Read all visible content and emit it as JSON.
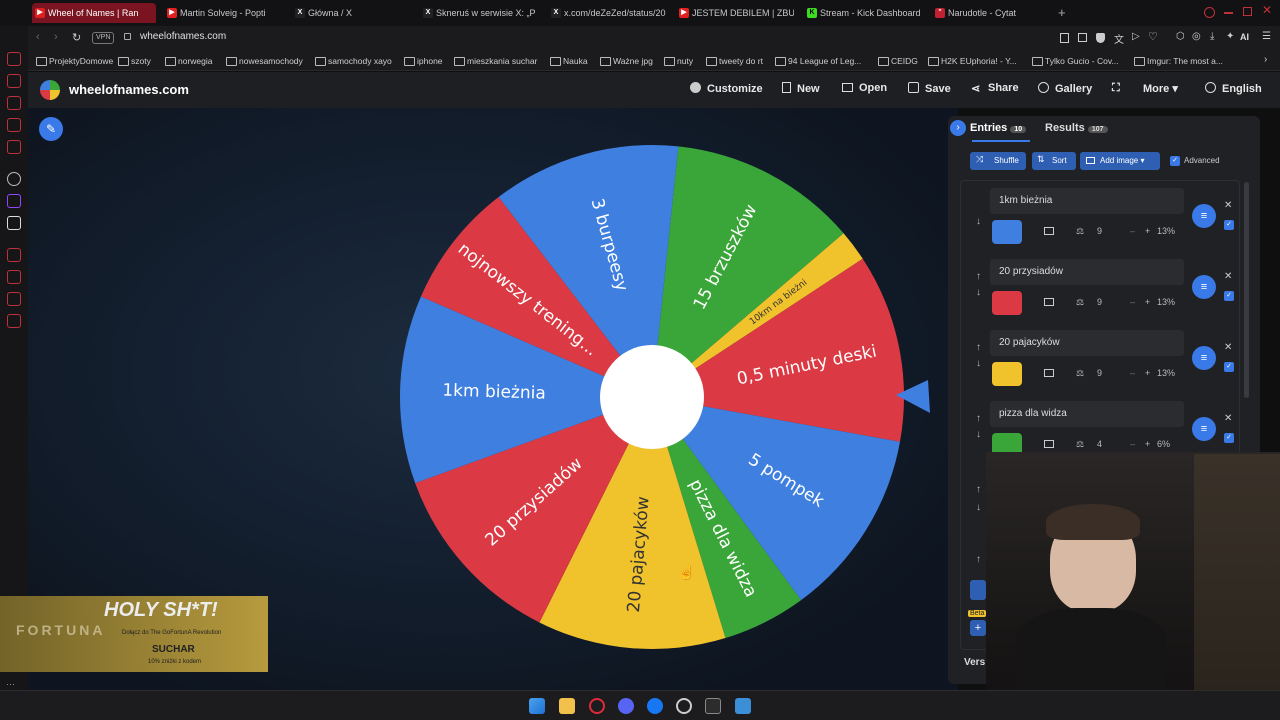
{
  "browser": {
    "tabs": [
      {
        "title": "Wheel of Names | Ran",
        "active": true,
        "icon": "youtube-icon"
      },
      {
        "title": "Martin Solveig - Popti",
        "icon": "youtube-icon"
      },
      {
        "title": "Główna / X",
        "icon": "x-icon"
      },
      {
        "title": "Skneruś w serwisie X: „P",
        "icon": "x-icon"
      },
      {
        "title": "x.com/deZeZed/status/20",
        "icon": "x-icon"
      },
      {
        "title": "JESTEM DEBILEM | ZBUD",
        "icon": "youtube-icon"
      },
      {
        "title": "Stream - Kick Dashboard",
        "icon": "kick-icon"
      },
      {
        "title": "Narudotle - Cytat",
        "icon": "quote-icon"
      }
    ],
    "address": "wheelofnames.com",
    "vpn_label": "VPN",
    "ai_label": "AI",
    "bookmarks": [
      "ProjektyDomowe",
      "szoty",
      "norwegia",
      "nowesamochody",
      "samochody xayo",
      "iphone",
      "mieszkania suchar",
      "Nauka",
      "Ważne jpg",
      "nuty",
      "tweety do rt",
      "94 League of Leg...",
      "CEIDG",
      "H2K EUphoria! - Y...",
      "Tylko Gucio - Cov...",
      "Imgur: The most a..."
    ]
  },
  "site": {
    "name": "wheelofnames.com",
    "menu": {
      "customize": "Customize",
      "new": "New",
      "open": "Open",
      "save": "Save",
      "share": "Share",
      "gallery": "Gallery",
      "more": "More",
      "language": "English"
    }
  },
  "wheel": {
    "segments": [
      {
        "label": "15 brzuszków",
        "color": "#3aa63a",
        "weight": 9
      },
      {
        "label": "10km na bieżni",
        "color": "#f0c22c",
        "weight": 1.5
      },
      {
        "label": "0,5 minuty deski",
        "color": "#db3a44",
        "weight": 9
      },
      {
        "label": "5 pompek",
        "color": "#3f7fe0",
        "weight": 9
      },
      {
        "label": "pizza dla widza",
        "color": "#3aa63a",
        "weight": 4
      },
      {
        "label": "20 pajacyków",
        "color": "#f0c22c",
        "weight": 9
      },
      {
        "label": "20 przysiadów",
        "color": "#db3a44",
        "weight": 9
      },
      {
        "label": "1km bieżnia",
        "color": "#3f7fe0",
        "weight": 9
      },
      {
        "label": "nojnowszy trening...",
        "color": "#db3a44",
        "weight": 6
      },
      {
        "label": "3 burpeesy",
        "color": "#3f7fe0",
        "weight": 9
      }
    ]
  },
  "panel": {
    "entries_tab": "Entries",
    "entries_count": "10",
    "results_tab": "Results",
    "results_count": "107",
    "shuffle_label": "Shuffle",
    "sort_label": "Sort",
    "add_image_label": "Add image",
    "advanced_label": "Advanced",
    "entries": [
      {
        "name": "1km bieżnia",
        "weight": "9",
        "percent": "13%",
        "color": "#3f7fe0"
      },
      {
        "name": "20 przysiadów",
        "weight": "9",
        "percent": "13%",
        "color": "#db3a44"
      },
      {
        "name": "20 pajacyków",
        "weight": "9",
        "percent": "13%",
        "color": "#f0c22c"
      },
      {
        "name": "pizza dla widza",
        "weight": "4",
        "percent": "6%",
        "color": "#3aa63a"
      }
    ],
    "version_label": "Vers",
    "beta_label": "Beta"
  },
  "overlay": {
    "headline": "HOLY SH*T!",
    "brand": "FORTUNA",
    "line1": "Dołącz do The GoFortunA Revolution",
    "code": "SUCHAR",
    "line2": "10% zniżki z kodem"
  }
}
